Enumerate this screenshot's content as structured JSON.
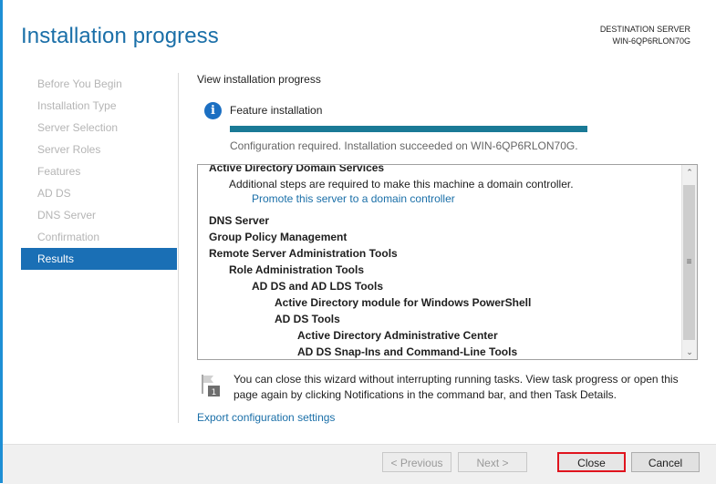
{
  "header": {
    "title": "Installation progress",
    "destination_label": "DESTINATION SERVER",
    "destination_server": "WIN-6QP6RLON70G"
  },
  "sidebar": {
    "items": [
      {
        "label": "Before You Begin",
        "active": false
      },
      {
        "label": "Installation Type",
        "active": false
      },
      {
        "label": "Server Selection",
        "active": false
      },
      {
        "label": "Server Roles",
        "active": false
      },
      {
        "label": "Features",
        "active": false
      },
      {
        "label": "AD DS",
        "active": false
      },
      {
        "label": "DNS Server",
        "active": false
      },
      {
        "label": "Confirmation",
        "active": false
      },
      {
        "label": "Results",
        "active": true
      }
    ]
  },
  "main": {
    "section_heading": "View installation progress",
    "feature_label": "Feature installation",
    "progress_percent": 100,
    "status_text": "Configuration required. Installation succeeded on WIN-6QP6RLON70G.",
    "results": [
      {
        "text": "Active Directory Domain Services",
        "style": "bold",
        "indent": 0
      },
      {
        "text": "Additional steps are required to make this machine a domain controller.",
        "style": "plain",
        "indent": 1
      },
      {
        "text": "Promote this server to a domain controller",
        "style": "link",
        "indent": 2
      },
      {
        "text": "DNS Server",
        "style": "bold",
        "indent": 0
      },
      {
        "text": "Group Policy Management",
        "style": "bold",
        "indent": 0
      },
      {
        "text": "Remote Server Administration Tools",
        "style": "bold",
        "indent": 0
      },
      {
        "text": "Role Administration Tools",
        "style": "bold",
        "indent": 1
      },
      {
        "text": "AD DS and AD LDS Tools",
        "style": "bold",
        "indent": 2
      },
      {
        "text": "Active Directory module for Windows PowerShell",
        "style": "bold",
        "indent": 3
      },
      {
        "text": "AD DS Tools",
        "style": "bold",
        "indent": 3
      },
      {
        "text": "Active Directory Administrative Center",
        "style": "bold",
        "indent": 4
      },
      {
        "text": "AD DS Snap-Ins and Command-Line Tools",
        "style": "bold",
        "indent": 4
      }
    ],
    "scroll_up_glyph": "⌃",
    "scroll_down_glyph": "⌄",
    "scroll_grip_glyph": "≡",
    "notice_text": "You can close this wizard without interrupting running tasks. View task progress or open this page again by clicking Notifications in the command bar, and then Task Details.",
    "notice_badge": "1",
    "export_link": "Export configuration settings"
  },
  "footer": {
    "previous_label": "< Previous",
    "next_label": "Next >",
    "close_label": "Close",
    "cancel_label": "Cancel"
  },
  "colors": {
    "accent": "#1a6fa8",
    "progress": "#1a7a96",
    "active_nav": "#1a6fb5",
    "highlight_border": "#e0141e"
  }
}
